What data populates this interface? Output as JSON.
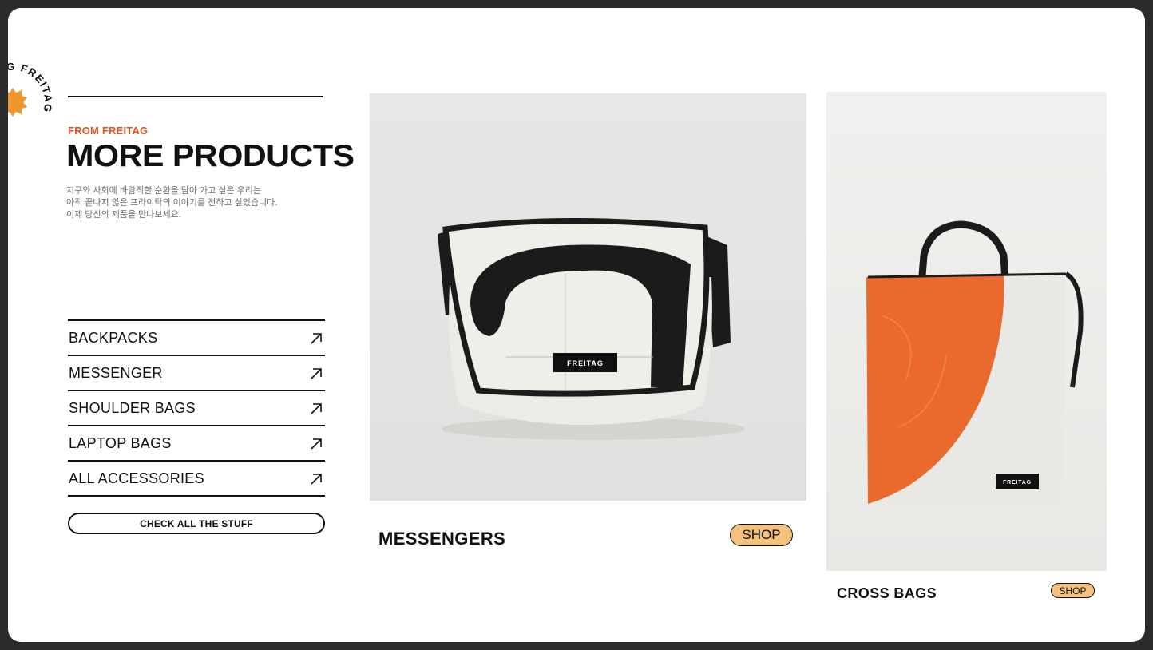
{
  "brand": {
    "badge_text": "FREITAG  FREITAG  ",
    "accent": "#e2531f"
  },
  "intro": {
    "eyebrow": "FROM FREITAG",
    "title": "MORE PRODUCTS",
    "description": [
      "지구와 사회에 바람직한 순환을 담아 가고 싶은 우리는",
      "아직 끝나지 않은 프라이탁의 이야기를 전하고 싶었습니다.",
      "이제 당신의 제품을 만나보세요."
    ]
  },
  "categories": [
    {
      "label": "BACKPACKS",
      "icon": "arrow-up-right-icon"
    },
    {
      "label": "MESSENGER",
      "icon": "arrow-up-right-icon"
    },
    {
      "label": "SHOULDER BAGS",
      "icon": "arrow-up-right-icon"
    },
    {
      "label": "LAPTOP BAGS",
      "icon": "arrow-up-right-icon"
    },
    {
      "label": "ALL ACCESSORIES",
      "icon": "arrow-up-right-icon"
    }
  ],
  "cta_label": "CHECK ALL THE STUFF",
  "products": [
    {
      "title": "MESSENGERS",
      "shop_label": "SHOP",
      "logo_text": "FREITAG"
    },
    {
      "title": "CROSS BAGS",
      "shop_label": "SHOP",
      "logo_text": "FREITAG"
    }
  ],
  "colors": {
    "shop_button": "#f5c27e",
    "bag_orange": "#e96a2c"
  }
}
